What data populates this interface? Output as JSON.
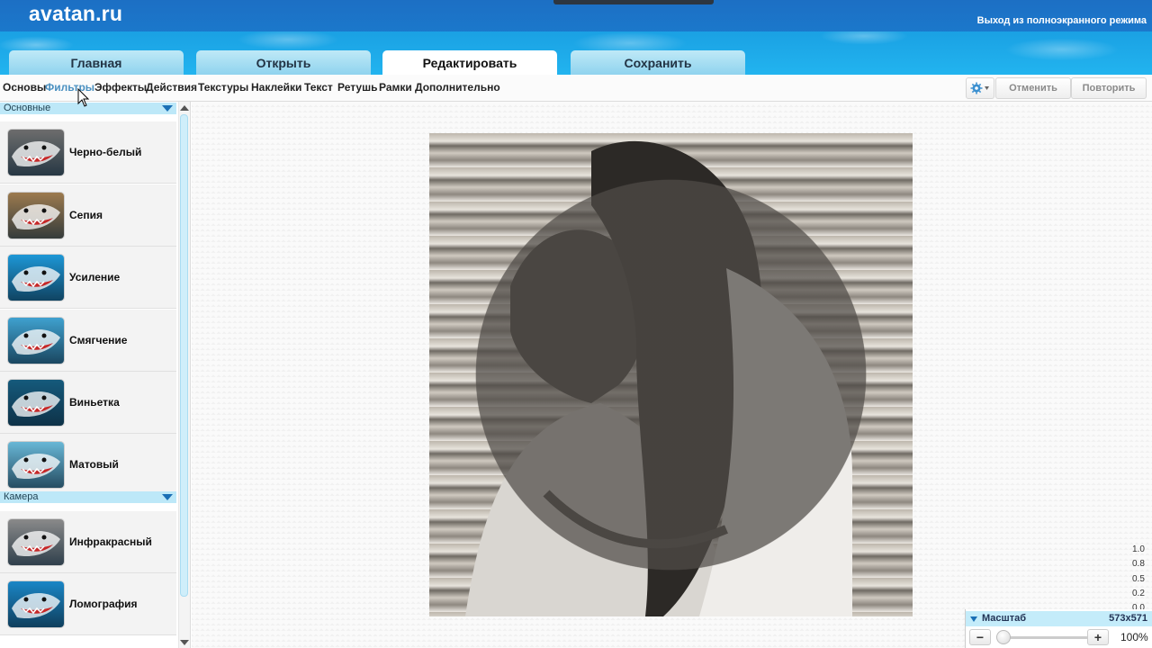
{
  "header": {
    "logo": "avatan.ru",
    "exit_fullscreen": "Выход из полноэкранного режима"
  },
  "tabs": [
    {
      "label": "Главная"
    },
    {
      "label": "Открыть"
    },
    {
      "label": "Редактировать",
      "active": true
    },
    {
      "label": "Сохранить"
    }
  ],
  "subtabs": [
    {
      "label": "Основы"
    },
    {
      "label": "Фильтры",
      "active": true
    },
    {
      "label": "Эффекты"
    },
    {
      "label": "Действия"
    },
    {
      "label": "Текстуры"
    },
    {
      "label": "Наклейки"
    },
    {
      "label": "Текст"
    },
    {
      "label": "Ретушь"
    },
    {
      "label": "Рамки"
    },
    {
      "label": "Дополнительно"
    }
  ],
  "toolbar": {
    "settings_icon": "gear-icon",
    "undo_label": "Отменить",
    "redo_label": "Повторить"
  },
  "sidebar": {
    "sections": [
      {
        "title": "Основные",
        "items": [
          {
            "label": "Черно-белый",
            "thumb_color": "#6d6d6d"
          },
          {
            "label": "Сепия",
            "thumb_color": "#9c7a4e"
          },
          {
            "label": "Усиление",
            "thumb_color": "#1d97d6"
          },
          {
            "label": "Смягчение",
            "thumb_color": "#3fa1cf"
          },
          {
            "label": "Виньетка",
            "thumb_color": "#155a7c"
          },
          {
            "label": "Матовый",
            "thumb_color": "#68b7d6"
          }
        ]
      },
      {
        "title": "Камера",
        "items": [
          {
            "label": "Инфракрасный",
            "thumb_color": "#8a8a8a"
          },
          {
            "label": "Ломография",
            "thumb_color": "#1a86c6"
          }
        ]
      }
    ]
  },
  "zoom": {
    "title": "Масштаб",
    "size": "573x571",
    "percent": "100%",
    "minus": "−",
    "plus": "+"
  },
  "ruler": [
    "1.0",
    "0.8",
    "0.5",
    "0.2",
    "0.0"
  ],
  "colors": {
    "accent": "#1a6fb5",
    "header": "#1b78cb",
    "tab": "#8fd3ee",
    "section": "#bde8f8"
  }
}
